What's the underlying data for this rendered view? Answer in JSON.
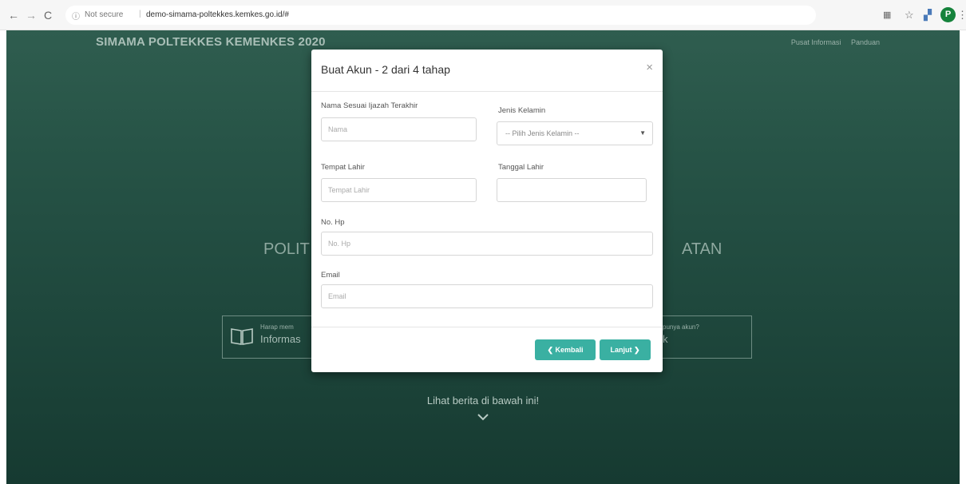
{
  "browser": {
    "nav_back": "←",
    "nav_forward": "→",
    "nav_reload": "C",
    "info_icon": "ⓘ",
    "security_status": "Not secure",
    "url": "demo-simama-poltekkes.kemkes.go.id/#",
    "extension1_icon": "▦",
    "bookmark_icon": "☆",
    "extension2_icon": "▞",
    "profile_initial": "P",
    "menu_icon": "⋮"
  },
  "page": {
    "brand": "SIMAMA POLTEKKES KEMENKES 2020",
    "topnav": [
      "Pusat Informasi",
      "Panduan"
    ],
    "hero_left": "POLIT",
    "hero_right": "ATAN",
    "info_box_left": {
      "small": "Harap mem",
      "big": "Informas"
    },
    "info_box_right": {
      "small": "punya akun?",
      "big": "k"
    },
    "news_text": "Lihat berita di bawah ini!",
    "chevron_icon": "⌄"
  },
  "modal": {
    "title": "Buat Akun - 2 dari 4 tahap",
    "close_icon": "×",
    "fields": {
      "nama_label": "Nama Sesuai Ijazah Terakhir",
      "nama_placeholder": "Nama",
      "jenis_kelamin_label": "Jenis Kelamin",
      "jenis_kelamin_value": "-- Pilih Jenis Kelamin --",
      "jenis_kelamin_arrow": "▼",
      "tempat_lahir_label": "Tempat Lahir",
      "tempat_lahir_placeholder": "Tempat Lahir",
      "tanggal_lahir_label": "Tanggal Lahir",
      "tanggal_lahir_value": "",
      "no_hp_label": "No. Hp",
      "no_hp_placeholder": "No. Hp",
      "email_label": "Email",
      "email_placeholder": "Email"
    },
    "buttons": {
      "back_label": "❮ Kembali",
      "next_label": "Lanjut ❯"
    }
  },
  "colors": {
    "accent": "#3ab0a2",
    "page_background": "#275447"
  }
}
